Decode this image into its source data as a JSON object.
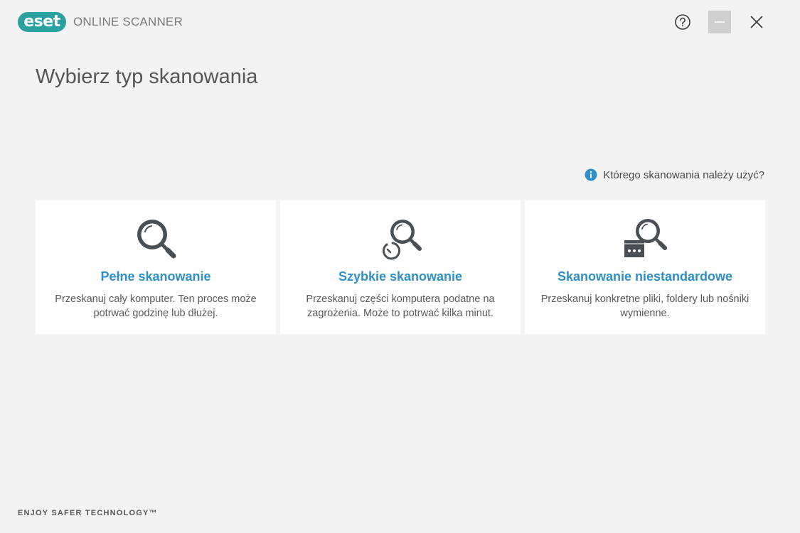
{
  "header": {
    "logo_text": "eset",
    "product_name": "ONLINE SCANNER",
    "help_icon": "question-circle-icon",
    "minimize_icon": "minimize-icon",
    "close_icon": "close-icon"
  },
  "page": {
    "title": "Wybierz typ skanowania",
    "help_link": "Którego skanowania należy użyć?"
  },
  "cards": [
    {
      "icon": "magnifier-icon",
      "title": "Pełne skanowanie",
      "desc": "Przeskanuj cały komputer. Ten proces może potrwać godzinę lub dłużej."
    },
    {
      "icon": "magnifier-clock-icon",
      "title": "Szybkie skanowanie",
      "desc": "Przeskanuj części komputera podatne na zagrożenia. Może to potrwać kilka minut."
    },
    {
      "icon": "magnifier-window-icon",
      "title": "Skanowanie niestandardowe",
      "desc": "Przeskanuj konkretne pliki, foldery lub nośniki wymienne."
    }
  ],
  "footer": {
    "tagline": "ENJOY SAFER TECHNOLOGY™"
  },
  "colors": {
    "accent": "#2f8fc6",
    "logo": "#2aa0a0",
    "background": "#f3f3f3",
    "icon": "#4a4f55"
  }
}
